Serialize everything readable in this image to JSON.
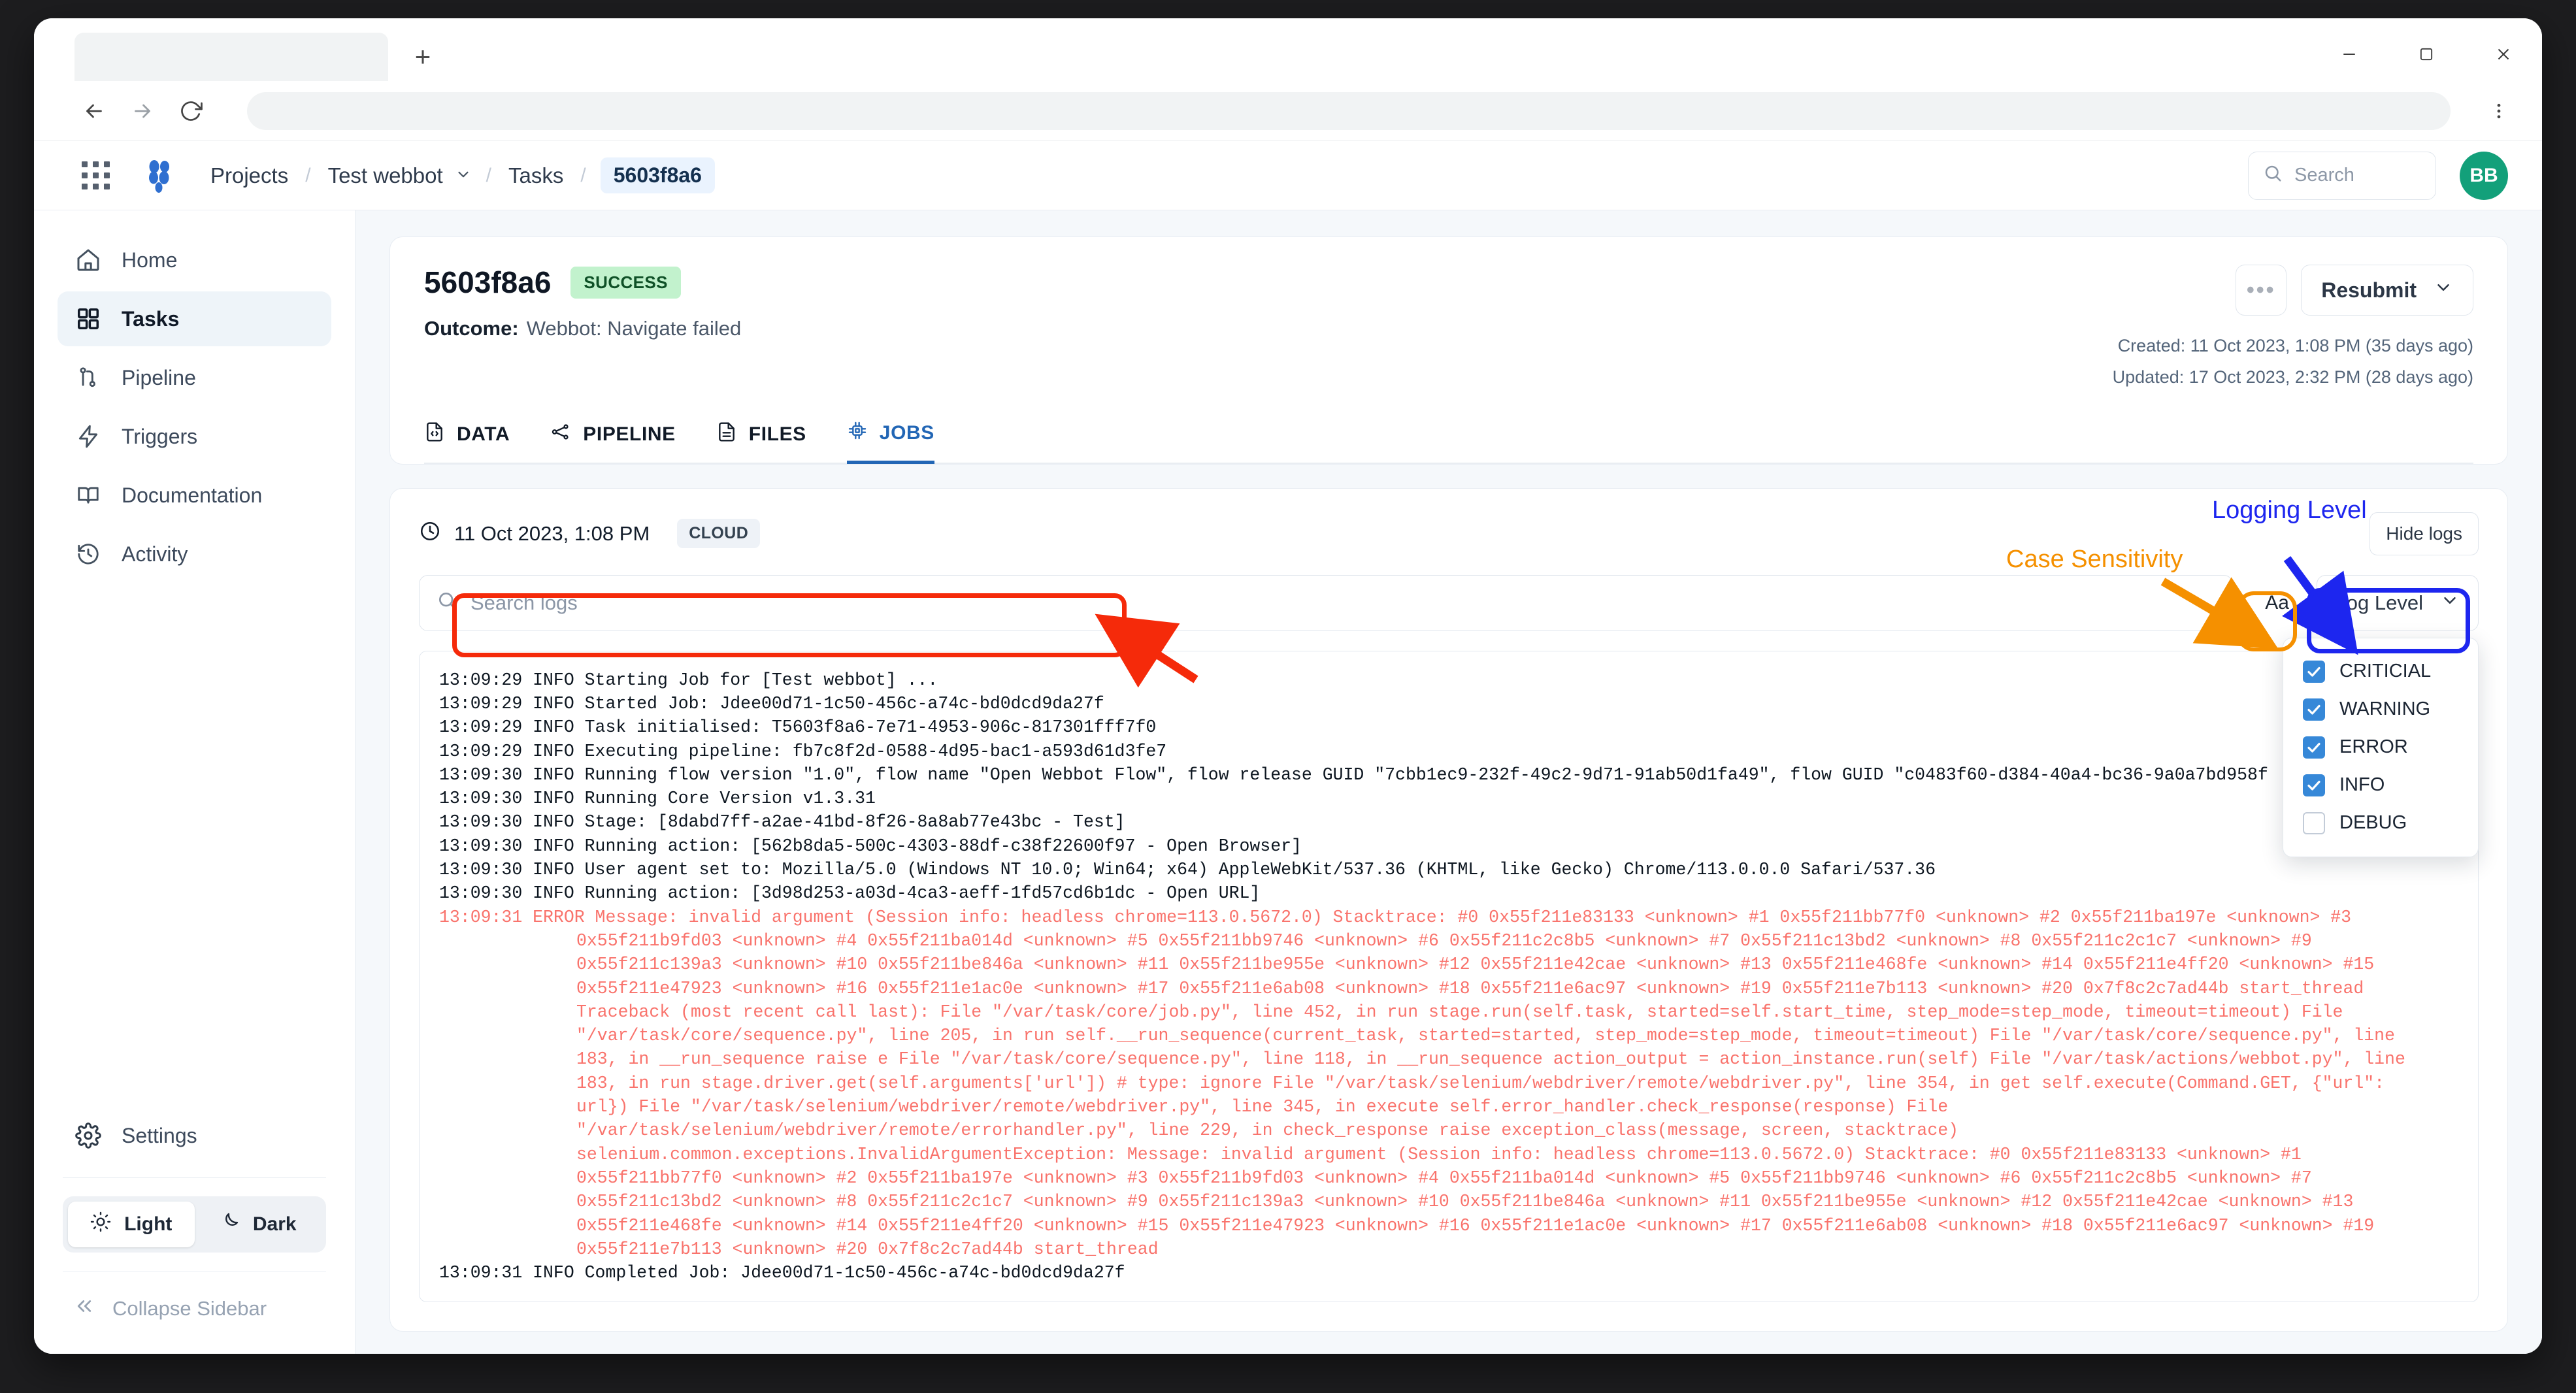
{
  "browser": {
    "new_tab_label": "+",
    "back_icon": "back-arrow-icon",
    "forward_icon": "forward-arrow-icon",
    "reload_icon": "reload-icon",
    "menu_icon": "kebab-menu-icon",
    "minimize_label": "–",
    "maximize_label": "☐",
    "close_label": "✕"
  },
  "appbar": {
    "apps_icon": "app-grid-icon",
    "logo_icon": "brand-logo-icon",
    "breadcrumb": {
      "projects": "Projects",
      "project": "Test webbot",
      "tasks": "Tasks",
      "current": "5603f8a6",
      "separator": "/"
    },
    "search_placeholder": "Search",
    "avatar_initials": "BB",
    "avatar_color": "#13a07a"
  },
  "sidebar": {
    "items": [
      {
        "label": "Home",
        "icon": "home-icon",
        "active": false
      },
      {
        "label": "Tasks",
        "icon": "grid-squares-icon",
        "active": true
      },
      {
        "label": "Pipeline",
        "icon": "git-branch-icon",
        "active": false
      },
      {
        "label": "Triggers",
        "icon": "lightning-bolt-icon",
        "active": false
      },
      {
        "label": "Documentation",
        "icon": "open-book-icon",
        "active": false
      },
      {
        "label": "Activity",
        "icon": "history-clock-icon",
        "active": false
      }
    ],
    "settings": {
      "label": "Settings",
      "icon": "gear-icon"
    },
    "theme": {
      "light": "Light",
      "dark": "Dark",
      "selected": "Light"
    },
    "collapse": "Collapse Sidebar"
  },
  "task": {
    "id": "5603f8a6",
    "status": "SUCCESS",
    "status_color": "#c2f2cd",
    "outcome_label": "Outcome:",
    "outcome_value": "Webbot: Navigate failed",
    "more_button": "•••",
    "resubmit_button": "Resubmit",
    "created": "Created: 11 Oct 2023, 1:08 PM (35 days ago)",
    "updated": "Updated: 17 Oct 2023, 2:32 PM (28 days ago)"
  },
  "tabs": [
    {
      "label": "DATA",
      "icon": "data-file-icon",
      "active": false
    },
    {
      "label": "PIPELINE",
      "icon": "pipeline-nodes-icon",
      "active": false
    },
    {
      "label": "FILES",
      "icon": "file-icon",
      "active": false
    },
    {
      "label": "JOBS",
      "icon": "chip-icon",
      "active": true
    }
  ],
  "logs_panel": {
    "job_time": "11 Oct 2023, 1:08 PM",
    "job_env": "CLOUD",
    "hide_logs": "Hide logs",
    "search_placeholder": "Search logs",
    "case_button": "Aa",
    "log_level_button": "Log Level",
    "log_level_options": [
      {
        "label": "CRITICIAL",
        "checked": true
      },
      {
        "label": "WARNING",
        "checked": true
      },
      {
        "label": "ERROR",
        "checked": true
      },
      {
        "label": "INFO",
        "checked": true
      },
      {
        "label": "DEBUG",
        "checked": false
      }
    ],
    "lines": [
      {
        "level": "INFO",
        "indent": false,
        "text": "13:09:29 INFO Starting Job for [Test webbot] ..."
      },
      {
        "level": "INFO",
        "indent": false,
        "text": "13:09:29 INFO Started Job: Jdee00d71-1c50-456c-a74c-bd0dcd9da27f"
      },
      {
        "level": "INFO",
        "indent": false,
        "text": "13:09:29 INFO Task initialised: T5603f8a6-7e71-4953-906c-817301fff7f0"
      },
      {
        "level": "INFO",
        "indent": false,
        "text": "13:09:29 INFO Executing pipeline: fb7c8f2d-0588-4d95-bac1-a593d61d3fe7"
      },
      {
        "level": "INFO",
        "indent": false,
        "text": "13:09:30 INFO Running flow version \"1.0\", flow name \"Open Webbot Flow\", flow release GUID \"7cbb1ec9-232f-49c2-9d71-91ab50d1fa49\", flow GUID \"c0483f60-d384-40a4-bc36-9a0a7bd958f"
      },
      {
        "level": "INFO",
        "indent": false,
        "text": "13:09:30 INFO Running Core Version v1.3.31"
      },
      {
        "level": "INFO",
        "indent": false,
        "text": "13:09:30 INFO Stage: [8dabd7ff-a2ae-41bd-8f26-8a8ab77e43bc - Test]"
      },
      {
        "level": "INFO",
        "indent": false,
        "text": "13:09:30 INFO Running action: [562b8da5-500c-4303-88df-c38f22600f97 - Open Browser]"
      },
      {
        "level": "INFO",
        "indent": false,
        "text": "13:09:30 INFO User agent set to: Mozilla/5.0 (Windows NT 10.0; Win64; x64) AppleWebKit/537.36 (KHTML, like Gecko) Chrome/113.0.0.0 Safari/537.36"
      },
      {
        "level": "INFO",
        "indent": false,
        "text": "13:09:30 INFO Running action: [3d98d253-a03d-4ca3-aeff-1fd57cd6b1dc - Open URL]"
      },
      {
        "level": "ERROR",
        "indent": false,
        "text": "13:09:31 ERROR Message: invalid argument (Session info: headless chrome=113.0.5672.0) Stacktrace: #0 0x55f211e83133 <unknown> #1 0x55f211bb77f0 <unknown> #2 0x55f211ba197e <unknown> #3"
      },
      {
        "level": "ERROR",
        "indent": true,
        "text": "0x55f211b9fd03 <unknown> #4 0x55f211ba014d <unknown> #5 0x55f211bb9746 <unknown> #6 0x55f211c2c8b5 <unknown> #7 0x55f211c13bd2 <unknown> #8 0x55f211c2c1c7 <unknown> #9"
      },
      {
        "level": "ERROR",
        "indent": true,
        "text": "0x55f211c139a3 <unknown> #10 0x55f211be846a <unknown> #11 0x55f211be955e <unknown> #12 0x55f211e42cae <unknown> #13 0x55f211e468fe <unknown> #14 0x55f211e4ff20 <unknown> #15"
      },
      {
        "level": "ERROR",
        "indent": true,
        "text": "0x55f211e47923 <unknown> #16 0x55f211e1ac0e <unknown> #17 0x55f211e6ab08 <unknown> #18 0x55f211e6ac97 <unknown> #19 0x55f211e7b113 <unknown> #20 0x7f8c2c7ad44b start_thread"
      },
      {
        "level": "ERROR",
        "indent": true,
        "text": "Traceback (most recent call last): File \"/var/task/core/job.py\", line 452, in run stage.run(self.task, started=self.start_time, step_mode=step_mode, timeout=timeout) File"
      },
      {
        "level": "ERROR",
        "indent": true,
        "text": "\"/var/task/core/sequence.py\", line 205, in run self.__run_sequence(current_task, started=started, step_mode=step_mode, timeout=timeout) File \"/var/task/core/sequence.py\", line"
      },
      {
        "level": "ERROR",
        "indent": true,
        "text": "183, in __run_sequence raise e File \"/var/task/core/sequence.py\", line 118, in __run_sequence action_output = action_instance.run(self) File \"/var/task/actions/webbot.py\", line"
      },
      {
        "level": "ERROR",
        "indent": true,
        "text": "183, in run stage.driver.get(self.arguments['url']) # type: ignore File \"/var/task/selenium/webdriver/remote/webdriver.py\", line 354, in get self.execute(Command.GET, {\"url\":"
      },
      {
        "level": "ERROR",
        "indent": true,
        "text": "url}) File \"/var/task/selenium/webdriver/remote/webdriver.py\", line 345, in execute self.error_handler.check_response(response) File"
      },
      {
        "level": "ERROR",
        "indent": true,
        "text": "\"/var/task/selenium/webdriver/remote/errorhandler.py\", line 229, in check_response raise exception_class(message, screen, stacktrace)"
      },
      {
        "level": "ERROR",
        "indent": true,
        "text": "selenium.common.exceptions.InvalidArgumentException: Message: invalid argument (Session info: headless chrome=113.0.5672.0) Stacktrace: #0 0x55f211e83133 <unknown> #1"
      },
      {
        "level": "ERROR",
        "indent": true,
        "text": "0x55f211bb77f0 <unknown> #2 0x55f211ba197e <unknown> #3 0x55f211b9fd03 <unknown> #4 0x55f211ba014d <unknown> #5 0x55f211bb9746 <unknown> #6 0x55f211c2c8b5 <unknown> #7"
      },
      {
        "level": "ERROR",
        "indent": true,
        "text": "0x55f211c13bd2 <unknown> #8 0x55f211c2c1c7 <unknown> #9 0x55f211c139a3 <unknown> #10 0x55f211be846a <unknown> #11 0x55f211be955e <unknown> #12 0x55f211e42cae <unknown> #13"
      },
      {
        "level": "ERROR",
        "indent": true,
        "text": "0x55f211e468fe <unknown> #14 0x55f211e4ff20 <unknown> #15 0x55f211e47923 <unknown> #16 0x55f211e1ac0e <unknown> #17 0x55f211e6ab08 <unknown> #18 0x55f211e6ac97 <unknown> #19"
      },
      {
        "level": "ERROR",
        "indent": true,
        "text": "0x55f211e7b113 <unknown> #20 0x7f8c2c7ad44b start_thread"
      },
      {
        "level": "INFO",
        "indent": false,
        "text": "13:09:31 INFO Completed Job: Jdee00d71-1c50-456c-a74c-bd0dcd9da27f"
      }
    ]
  },
  "annotations": {
    "case_sensitivity": {
      "text": "Case Sensitivity",
      "color": "#f59000"
    },
    "logging_level": {
      "text": "Logging Level",
      "color": "#1d26ef"
    },
    "search_highlight_color": "#f52a0a"
  }
}
